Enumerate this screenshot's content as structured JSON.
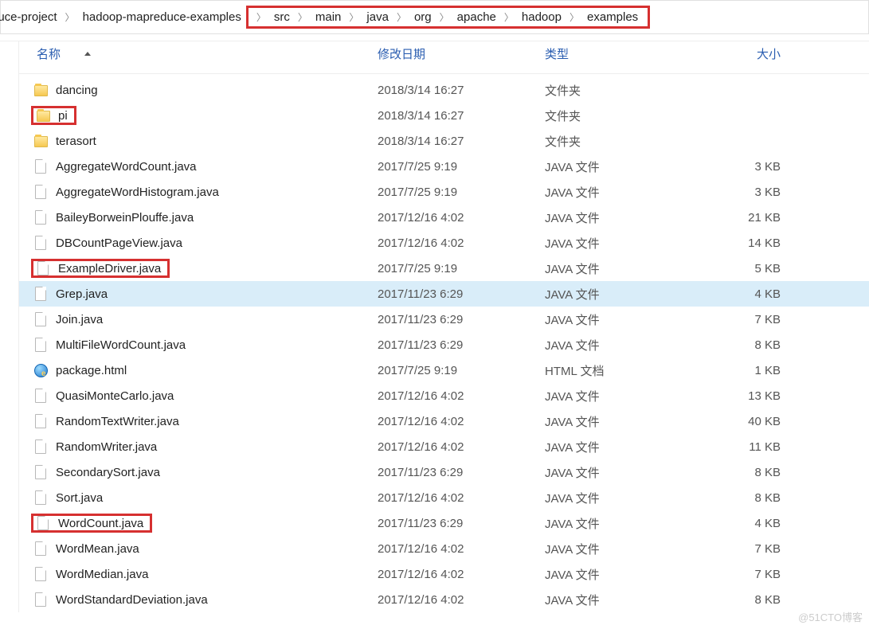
{
  "breadcrumb": {
    "items": [
      {
        "label": "duce-project",
        "hi": false,
        "cut": true
      },
      {
        "label": "hadoop-mapreduce-examples",
        "hi": false
      },
      {
        "label": "src",
        "hi": true
      },
      {
        "label": "main",
        "hi": true
      },
      {
        "label": "java",
        "hi": true
      },
      {
        "label": "org",
        "hi": true
      },
      {
        "label": "apache",
        "hi": true
      },
      {
        "label": "hadoop",
        "hi": true
      },
      {
        "label": "examples",
        "hi": true
      }
    ]
  },
  "headers": {
    "name": "名称",
    "date": "修改日期",
    "type": "类型",
    "size": "大小"
  },
  "rows": [
    {
      "name": "dancing",
      "date": "2018/3/14 16:27",
      "type": "文件夹",
      "size": "",
      "icon": "folder",
      "hi": false
    },
    {
      "name": "pi",
      "date": "2018/3/14 16:27",
      "type": "文件夹",
      "size": "",
      "icon": "folder",
      "hi": true
    },
    {
      "name": "terasort",
      "date": "2018/3/14 16:27",
      "type": "文件夹",
      "size": "",
      "icon": "folder",
      "hi": false
    },
    {
      "name": "AggregateWordCount.java",
      "date": "2017/7/25 9:19",
      "type": "JAVA 文件",
      "size": "3 KB",
      "icon": "file",
      "hi": false
    },
    {
      "name": "AggregateWordHistogram.java",
      "date": "2017/7/25 9:19",
      "type": "JAVA 文件",
      "size": "3 KB",
      "icon": "file",
      "hi": false
    },
    {
      "name": "BaileyBorweinPlouffe.java",
      "date": "2017/12/16 4:02",
      "type": "JAVA 文件",
      "size": "21 KB",
      "icon": "file",
      "hi": false
    },
    {
      "name": "DBCountPageView.java",
      "date": "2017/12/16 4:02",
      "type": "JAVA 文件",
      "size": "14 KB",
      "icon": "file",
      "hi": false
    },
    {
      "name": "ExampleDriver.java",
      "date": "2017/7/25 9:19",
      "type": "JAVA 文件",
      "size": "5 KB",
      "icon": "file",
      "hi": true
    },
    {
      "name": "Grep.java",
      "date": "2017/11/23 6:29",
      "type": "JAVA 文件",
      "size": "4 KB",
      "icon": "file",
      "hi": false,
      "sel": true
    },
    {
      "name": "Join.java",
      "date": "2017/11/23 6:29",
      "type": "JAVA 文件",
      "size": "7 KB",
      "icon": "file",
      "hi": false
    },
    {
      "name": "MultiFileWordCount.java",
      "date": "2017/11/23 6:29",
      "type": "JAVA 文件",
      "size": "8 KB",
      "icon": "file",
      "hi": false
    },
    {
      "name": "package.html",
      "date": "2017/7/25 9:19",
      "type": "HTML 文档",
      "size": "1 KB",
      "icon": "html",
      "hi": false
    },
    {
      "name": "QuasiMonteCarlo.java",
      "date": "2017/12/16 4:02",
      "type": "JAVA 文件",
      "size": "13 KB",
      "icon": "file",
      "hi": false
    },
    {
      "name": "RandomTextWriter.java",
      "date": "2017/12/16 4:02",
      "type": "JAVA 文件",
      "size": "40 KB",
      "icon": "file",
      "hi": false
    },
    {
      "name": "RandomWriter.java",
      "date": "2017/12/16 4:02",
      "type": "JAVA 文件",
      "size": "11 KB",
      "icon": "file",
      "hi": false
    },
    {
      "name": "SecondarySort.java",
      "date": "2017/11/23 6:29",
      "type": "JAVA 文件",
      "size": "8 KB",
      "icon": "file",
      "hi": false
    },
    {
      "name": "Sort.java",
      "date": "2017/12/16 4:02",
      "type": "JAVA 文件",
      "size": "8 KB",
      "icon": "file",
      "hi": false
    },
    {
      "name": "WordCount.java",
      "date": "2017/11/23 6:29",
      "type": "JAVA 文件",
      "size": "4 KB",
      "icon": "file",
      "hi": true
    },
    {
      "name": "WordMean.java",
      "date": "2017/12/16 4:02",
      "type": "JAVA 文件",
      "size": "7 KB",
      "icon": "file",
      "hi": false
    },
    {
      "name": "WordMedian.java",
      "date": "2017/12/16 4:02",
      "type": "JAVA 文件",
      "size": "7 KB",
      "icon": "file",
      "hi": false
    },
    {
      "name": "WordStandardDeviation.java",
      "date": "2017/12/16 4:02",
      "type": "JAVA 文件",
      "size": "8 KB",
      "icon": "file",
      "hi": false
    }
  ],
  "watermark": "@51CTO博客"
}
